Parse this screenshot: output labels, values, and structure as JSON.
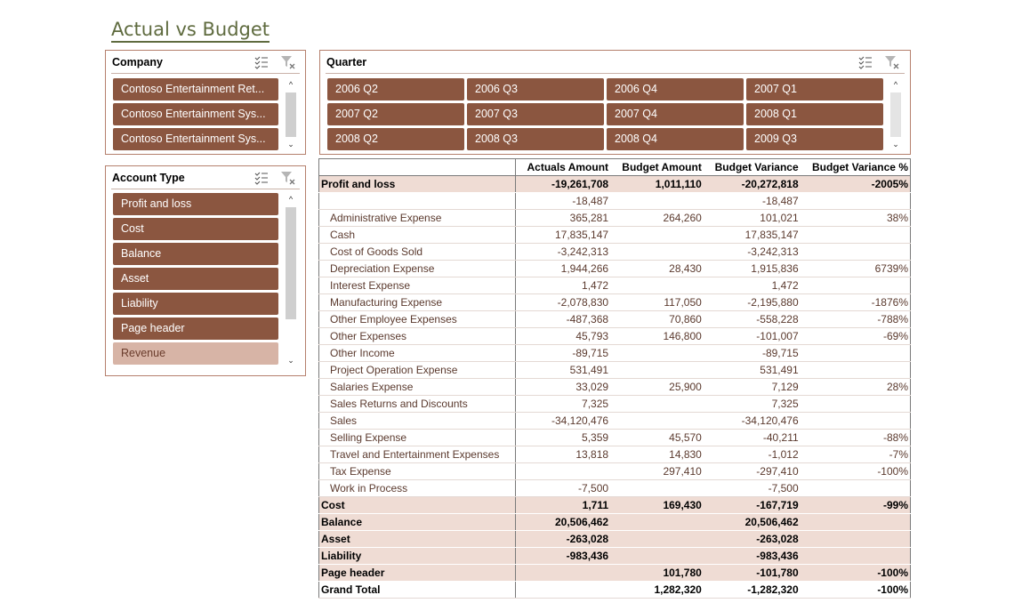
{
  "page_title": "Actual vs Budget",
  "company_slicer": {
    "title": "Company",
    "items": [
      "Contoso Entertainment Ret...",
      "Contoso Entertainment Sys...",
      "Contoso Entertainment Sys..."
    ]
  },
  "quarter_slicer": {
    "title": "Quarter",
    "items": [
      "2006 Q2",
      "2006 Q3",
      "2006 Q4",
      "2007 Q1",
      "2007 Q2",
      "2007 Q3",
      "2007 Q4",
      "2008 Q1",
      "2008 Q2",
      "2008 Q3",
      "2008 Q4",
      "2009 Q3"
    ]
  },
  "account_slicer": {
    "title": "Account Type",
    "items": [
      "Profit and loss",
      "Cost",
      "Balance",
      "Asset",
      "Liability",
      "Page header",
      "Revenue"
    ]
  },
  "table": {
    "headers": [
      "",
      "Actuals Amount",
      "Budget Amount",
      "Budget Variance",
      "Budget Variance %"
    ],
    "rows": [
      {
        "type": "cat",
        "cells": [
          "Profit and loss",
          "-19,261,708",
          "1,011,110",
          "-20,272,818",
          "-2005%"
        ]
      },
      {
        "type": "sub",
        "cells": [
          "",
          "-18,487",
          "",
          "-18,487",
          ""
        ]
      },
      {
        "type": "sub",
        "cells": [
          "Administrative Expense",
          "365,281",
          "264,260",
          "101,021",
          "38%"
        ]
      },
      {
        "type": "sub",
        "cells": [
          "Cash",
          "17,835,147",
          "",
          "17,835,147",
          ""
        ]
      },
      {
        "type": "sub",
        "cells": [
          "Cost of Goods Sold",
          "-3,242,313",
          "",
          "-3,242,313",
          ""
        ]
      },
      {
        "type": "sub",
        "cells": [
          "Depreciation Expense",
          "1,944,266",
          "28,430",
          "1,915,836",
          "6739%"
        ]
      },
      {
        "type": "sub",
        "cells": [
          "Interest Expense",
          "1,472",
          "",
          "1,472",
          ""
        ]
      },
      {
        "type": "sub",
        "cells": [
          "Manufacturing Expense",
          "-2,078,830",
          "117,050",
          "-2,195,880",
          "-1876%"
        ]
      },
      {
        "type": "sub",
        "cells": [
          "Other Employee Expenses",
          "-487,368",
          "70,860",
          "-558,228",
          "-788%"
        ]
      },
      {
        "type": "sub",
        "cells": [
          "Other Expenses",
          "45,793",
          "146,800",
          "-101,007",
          "-69%"
        ]
      },
      {
        "type": "sub",
        "cells": [
          "Other Income",
          "-89,715",
          "",
          "-89,715",
          ""
        ]
      },
      {
        "type": "sub",
        "cells": [
          "Project Operation Expense",
          "531,491",
          "",
          "531,491",
          ""
        ]
      },
      {
        "type": "sub",
        "cells": [
          "Salaries Expense",
          "33,029",
          "25,900",
          "7,129",
          "28%"
        ]
      },
      {
        "type": "sub",
        "cells": [
          "Sales Returns and Discounts",
          "7,325",
          "",
          "7,325",
          ""
        ]
      },
      {
        "type": "sub",
        "cells": [
          "Sales",
          "-34,120,476",
          "",
          "-34,120,476",
          ""
        ]
      },
      {
        "type": "sub",
        "cells": [
          "Selling Expense",
          "5,359",
          "45,570",
          "-40,211",
          "-88%"
        ]
      },
      {
        "type": "sub",
        "cells": [
          "Travel and Entertainment Expenses",
          "13,818",
          "14,830",
          "-1,012",
          "-7%"
        ]
      },
      {
        "type": "sub",
        "cells": [
          "Tax Expense",
          "",
          "297,410",
          "-297,410",
          "-100%"
        ]
      },
      {
        "type": "sub",
        "cells": [
          "Work in Process",
          "-7,500",
          "",
          "-7,500",
          ""
        ]
      },
      {
        "type": "cat",
        "cells": [
          "Cost",
          "1,711",
          "169,430",
          "-167,719",
          "-99%"
        ]
      },
      {
        "type": "cat",
        "cells": [
          "Balance",
          "20,506,462",
          "",
          "20,506,462",
          ""
        ]
      },
      {
        "type": "cat",
        "cells": [
          "Asset",
          "-263,028",
          "",
          "-263,028",
          ""
        ]
      },
      {
        "type": "cat",
        "cells": [
          "Liability",
          "-983,436",
          "",
          "-983,436",
          ""
        ]
      },
      {
        "type": "cat",
        "cells": [
          "Page header",
          "",
          "101,780",
          "-101,780",
          "-100%"
        ]
      },
      {
        "type": "total",
        "cells": [
          "Grand Total",
          "",
          "1,282,320",
          "-1,282,320",
          "-100%"
        ]
      }
    ]
  },
  "icons": {
    "multiselect": "multi-select-icon",
    "clear_filter": "clear-filter-icon",
    "scroll_up": "scroll-up-icon",
    "scroll_down": "scroll-down-icon"
  },
  "colors": {
    "item_selected": "#8b5640",
    "item_unselected": "#d7b4a6",
    "category_row": "#efdcd4",
    "title": "#5f6b3f"
  }
}
